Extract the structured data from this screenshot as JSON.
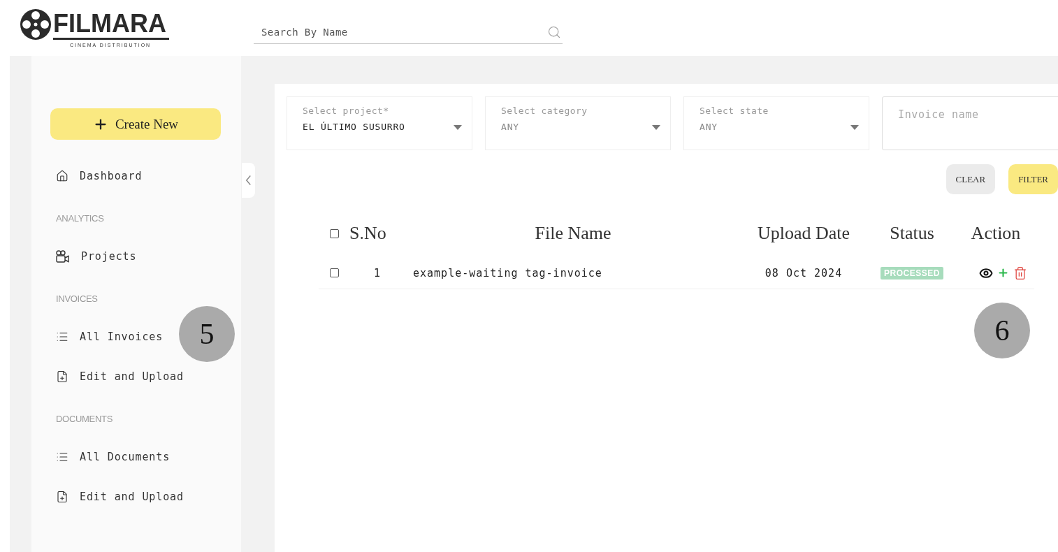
{
  "header": {
    "logo": {
      "name": "FILMARA",
      "tagline": "CINEMA DISTRIBUTION"
    },
    "search": {
      "placeholder": "Search By Name"
    }
  },
  "sidebar": {
    "create_button": {
      "label": "Create New"
    },
    "sections": [
      {
        "items": [
          {
            "kind": "home",
            "label": "Dashboard",
            "selected": false
          }
        ]
      },
      {
        "heading": "ANALYTICS",
        "items": [
          {
            "kind": "projects",
            "label": "Projects",
            "selected": false
          }
        ]
      },
      {
        "heading": "INVOICES",
        "items": [
          {
            "kind": "list",
            "label": "All Invoices",
            "selected": false
          },
          {
            "kind": "upload",
            "label": "Edit and Upload",
            "selected": false
          }
        ]
      },
      {
        "heading": "DOCUMENTS",
        "items": [
          {
            "kind": "list",
            "label": "All Documents",
            "selected": false
          },
          {
            "kind": "upload",
            "label": "Edit and Upload",
            "selected": false
          }
        ]
      }
    ]
  },
  "filters": [
    {
      "kind": "select",
      "label": "Select project*",
      "value": "EL ÚLTIMO SUSURRO",
      "default": false
    },
    {
      "kind": "select",
      "label": "Select category",
      "value": "ANY",
      "default": true
    },
    {
      "kind": "select",
      "label": "Select state",
      "value": "ANY",
      "default": true
    },
    {
      "kind": "text",
      "placeholder": "Invoice name"
    }
  ],
  "buttons": [
    {
      "kind": "clear",
      "label": "CLEAR"
    },
    {
      "kind": "filter",
      "label": "FILTER"
    }
  ],
  "table": {
    "select_all": {
      "checked": false
    },
    "columns": [
      "S.No",
      "File Name",
      "Upload Date",
      "Status",
      "Action"
    ],
    "rows": [
      {
        "checked": false,
        "sno": "1",
        "file_name": "example-waiting tag-invoice",
        "upload_date": "08 Oct 2024",
        "status": "PROCESSED"
      }
    ]
  },
  "callouts": [
    "5",
    "6"
  ]
}
